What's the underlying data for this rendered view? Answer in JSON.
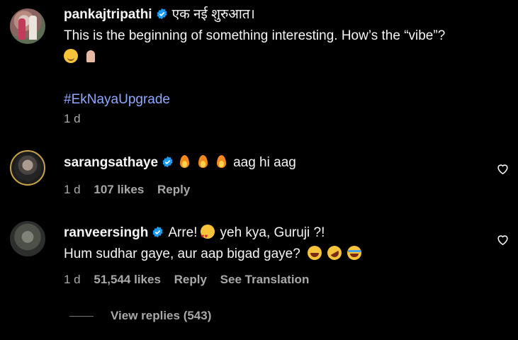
{
  "comments": [
    {
      "username": "pankajtripathi",
      "verified": true,
      "line1": "एक नई शुरुआत।",
      "line2": "This is the beginning of something interesting. How’s the “vibe”?",
      "emojis": [
        "smiling-face",
        "folded-hands"
      ],
      "hashtag": "#EkNayaUpgrade",
      "time": "1 d"
    },
    {
      "username": "sarangsathaye",
      "verified": true,
      "emojis": [
        "fire",
        "fire",
        "fire"
      ],
      "text": "aag hi aag",
      "time": "1 d",
      "likes": "107 likes",
      "reply": "Reply"
    },
    {
      "username": "ranveersingh",
      "verified": true,
      "text_a": "Arre!",
      "text_b": "yeh kya, Guruji ?!",
      "line2": "Hum sudhar gaye, aur aap bigad gaye?",
      "time": "1 d",
      "likes": "51,544 likes",
      "reply": "Reply",
      "translate": "See Translation"
    }
  ],
  "view_replies": "View replies (543)",
  "colors": {
    "background": "#000000",
    "text": "#f5f5f5",
    "meta": "#a8a8a8",
    "hashtag": "#8fa8ff",
    "verified": "#1d9bf0"
  }
}
